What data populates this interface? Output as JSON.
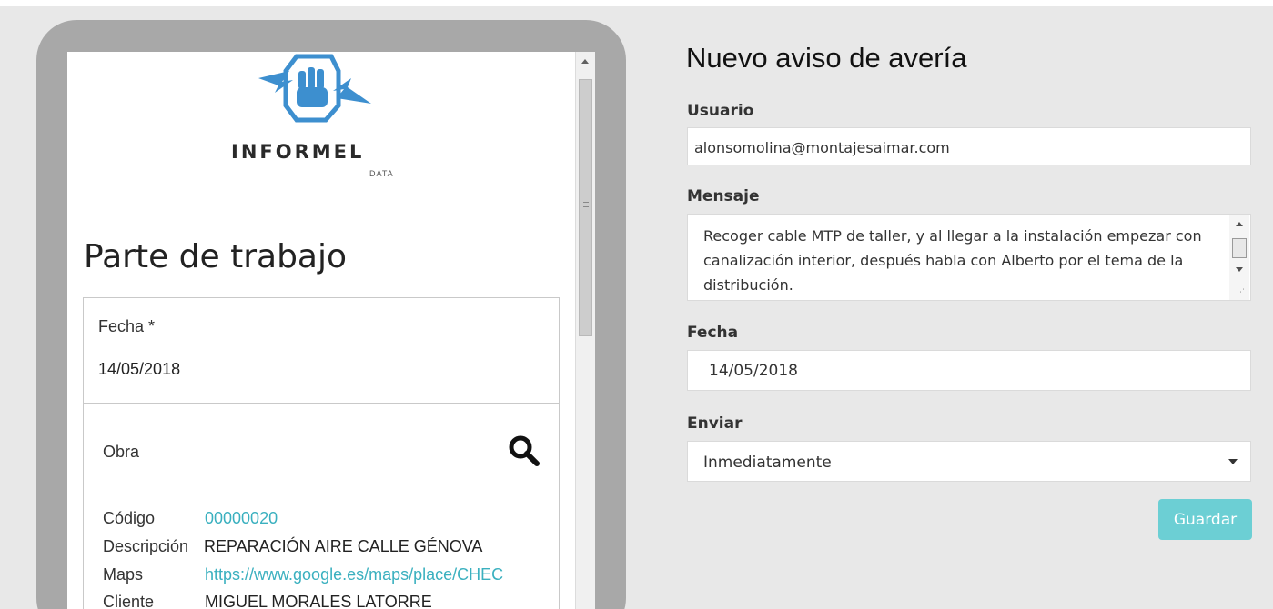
{
  "phone": {
    "brand": "INFORMEL",
    "brand_sub": "DATA",
    "page_title": "Parte de trabajo",
    "fecha_label": "Fecha *",
    "fecha_value": "14/05/2018",
    "obra_label": "Obra",
    "rows": [
      {
        "label": "Código",
        "value": "00000020"
      },
      {
        "label": "Descripción",
        "value": "REPARACIÓN AIRE CALLE GÉNOVA"
      },
      {
        "label": "Maps",
        "value": "https://www.google.es/maps/place/CHEC"
      },
      {
        "label": "Cliente",
        "value": "MIGUEL MORALES LATORRE"
      }
    ]
  },
  "form": {
    "title": "Nuevo aviso de avería",
    "usuario_label": "Usuario",
    "usuario_value": "alonsomolina@montajesaimar.com",
    "mensaje_label": "Mensaje",
    "mensaje_value": "Recoger cable MTP de taller, y al llegar a la instalación empezar con canalización interior, después habla con Alberto por el tema de la distribución.",
    "fecha_label": "Fecha",
    "fecha_value": "14/05/2018",
    "enviar_label": "Enviar",
    "enviar_value": "Inmediatamente",
    "save_label": "Guardar"
  },
  "colors": {
    "link": "#3ab0bf",
    "save_button": "#6ccfd4",
    "logo_blue": "#3d8fcf"
  },
  "icons": [
    "fist-lightning-logo",
    "search-icon",
    "chevron-down-icon"
  ]
}
